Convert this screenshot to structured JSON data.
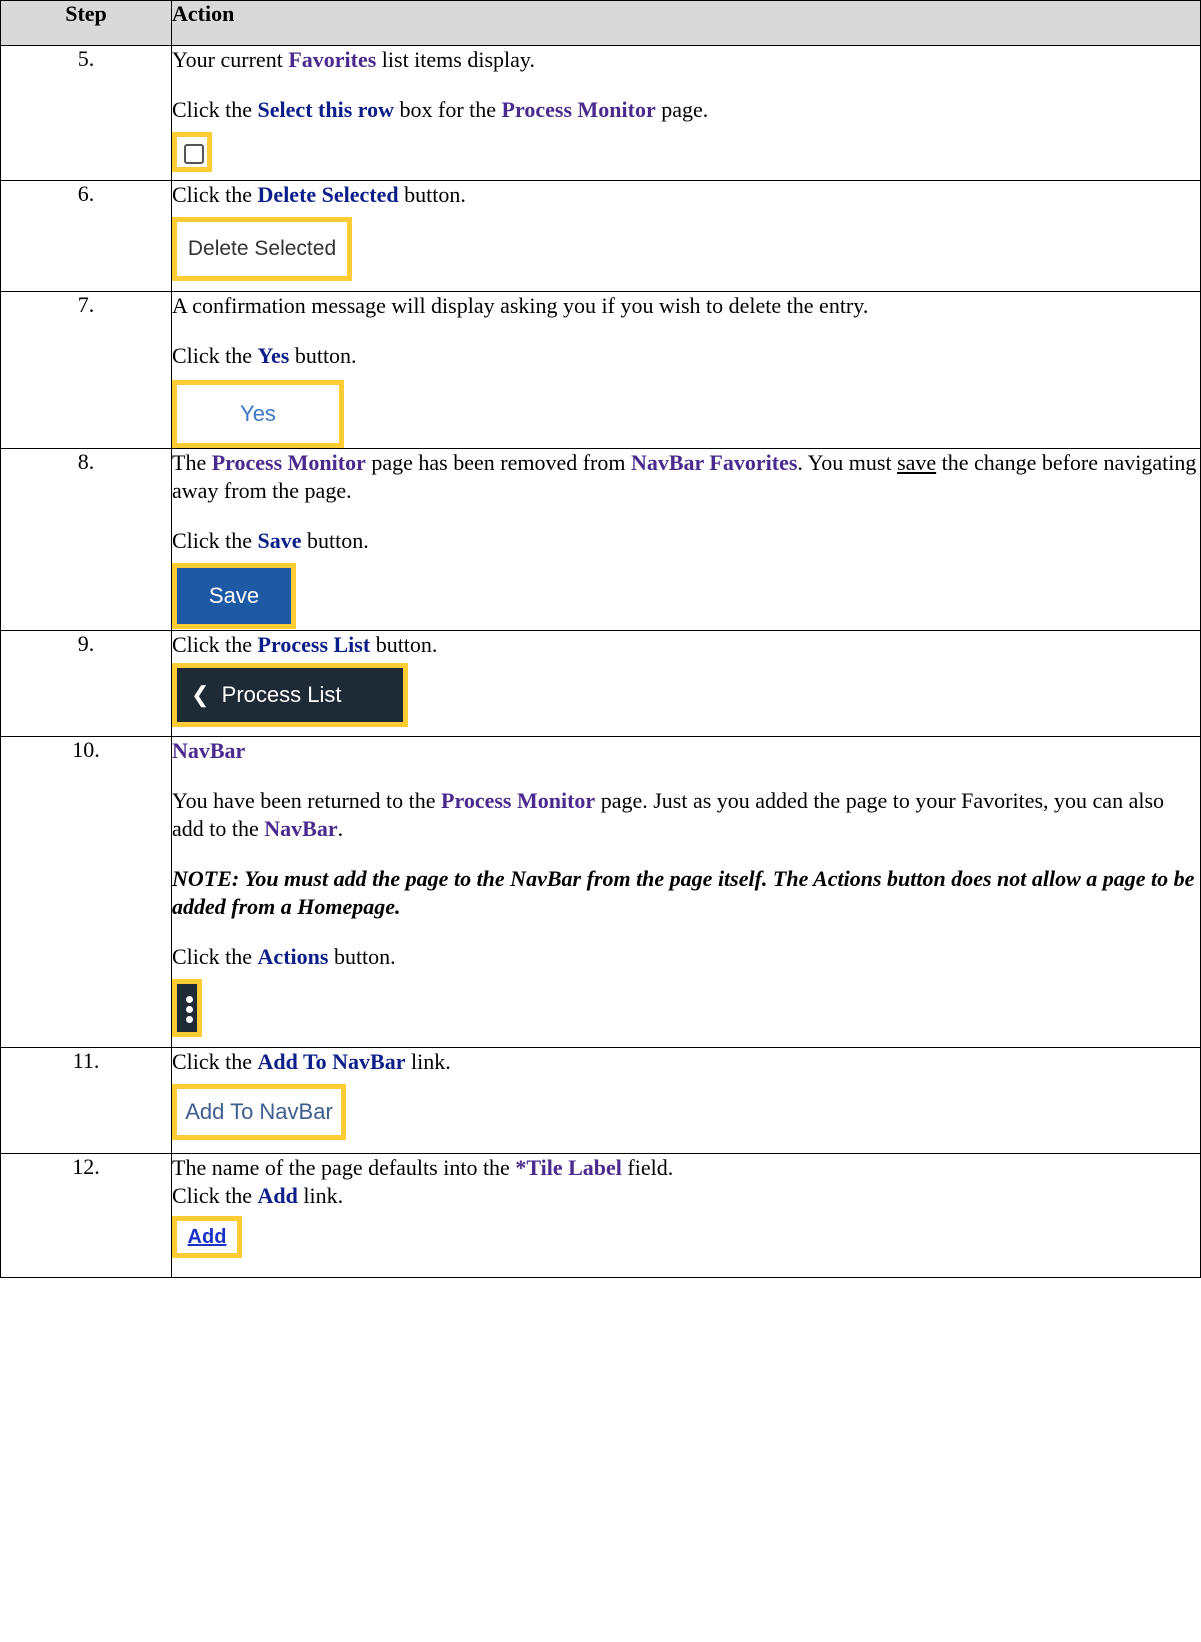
{
  "header": {
    "step": "Step",
    "action": "Action"
  },
  "rows": [
    {
      "num": "5.",
      "p1": "Your current ",
      "p1_b": "Favorites",
      "p1_end": " list items display.",
      "p2": "Click the ",
      "p2_b": "Select this row",
      "p2_mid": " box for the ",
      "p2_b2": "Process Monitor",
      "p2_end": " page."
    },
    {
      "num": "6.",
      "p1": "Click the ",
      "p1_b": "Delete Selected",
      "p1_end": " button.",
      "button": "Delete Selected"
    },
    {
      "num": "7.",
      "p1": "A confirmation message will display asking you if you wish to delete the entry.",
      "p2": "Click the ",
      "p2_b": "Yes",
      "p2_end": " button.",
      "button": "Yes"
    },
    {
      "num": "8.",
      "p1": "The ",
      "p1_b": "Process Monitor",
      "p1_mid": " page has been removed from ",
      "p1_b2": "NavBar Favorites",
      "p1_mid2": ". You must ",
      "p1_u": "save",
      "p1_end": " the change before navigating away from the page.",
      "p2": "Click the ",
      "p2_b": "Save",
      "p2_end": " button.",
      "button": "Save"
    },
    {
      "num": "9.",
      "p1": "Click the ",
      "p1_b": "Process List",
      "p1_end": " button.",
      "button": "Process List"
    },
    {
      "num": "10.",
      "heading": "NavBar",
      "p1": "You have been returned to the ",
      "p1_b": "Process Monitor",
      "p1_mid": " page. Just as you added the page to your Favorites, you can also add to the ",
      "p1_b2": "NavBar",
      "p1_end": ".",
      "note": "NOTE: You must add the page to the NavBar from the page itself. The Actions button does not allow a page to be added from a Homepage.",
      "p2": "Click the ",
      "p2_b": "Actions",
      "p2_end": " button."
    },
    {
      "num": "11.",
      "p1": "Click the ",
      "p1_b": "Add To NavBar",
      "p1_end": " link.",
      "button": "Add To NavBar"
    },
    {
      "num": "12.",
      "p1": "The name of the page defaults into the ",
      "p1_b": "*Tile Label",
      "p1_end": " field.",
      "p2": "Click the ",
      "p2_b": "Add",
      "p2_end": " link.",
      "button": "Add"
    }
  ],
  "colors": {
    "highlight": "#ffcc33",
    "keyword_blue": "#0b1e8a",
    "keyword_purple": "#4b2a8f",
    "header_bg": "#d9d9d9"
  }
}
